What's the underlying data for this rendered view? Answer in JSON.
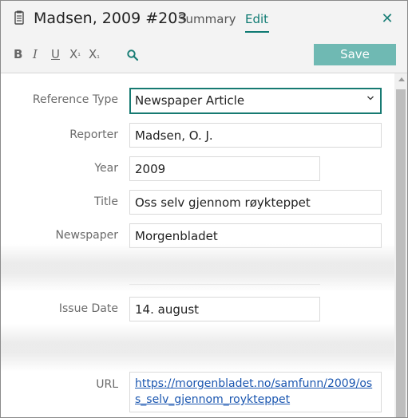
{
  "header": {
    "title": "Madsen, 2009 #203",
    "tabs": [
      {
        "label": "Summary"
      },
      {
        "label": "Edit"
      }
    ],
    "close_label": "✕"
  },
  "toolbar": {
    "bold": "B",
    "italic": "I",
    "underline": "U",
    "superscript": "X",
    "superscript_mark": "¹",
    "subscript": "X",
    "subscript_mark": "₁",
    "save_label": "Save"
  },
  "form": {
    "reference_type": {
      "label": "Reference Type",
      "value": "Newspaper Article"
    },
    "reporter": {
      "label": "Reporter",
      "value": "Madsen, O. J."
    },
    "year": {
      "label": "Year",
      "value": "2009"
    },
    "title": {
      "label": "Title",
      "value": "Oss selv gjennom røykteppet"
    },
    "newspaper": {
      "label": "Newspaper",
      "value": "Morgenbladet"
    },
    "issue_date": {
      "label": "Issue Date",
      "value": "14. august"
    },
    "url": {
      "label": "URL",
      "value": "https://morgenbladet.no/samfunn/2009/oss_selv_gjennom_roykteppet"
    }
  },
  "colors": {
    "accent": "#0e7a72",
    "save_button": "#6fb9b3",
    "link": "#1a56b0"
  }
}
